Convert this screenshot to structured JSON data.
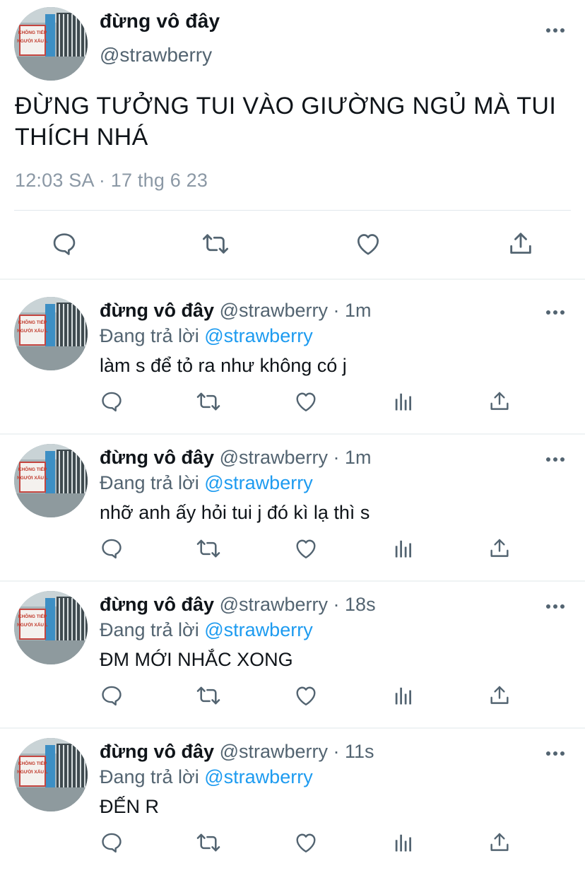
{
  "main_tweet": {
    "display_name": "đừng vô đây",
    "handle": "@strawberry",
    "text": "ĐỪNG TƯỞNG TUI VÀO GIƯỜNG NGỦ MÀ TUI THÍCH NHÁ",
    "timestamp": "12:03 SA · 17 thg 6 23",
    "avatar_sign_text": [
      "KHÔNG TIẾP",
      "NGƯỜI XẤU L"
    ],
    "actions": [
      "reply-icon",
      "retweet-icon",
      "like-icon",
      "share-icon"
    ]
  },
  "replies": [
    {
      "display_name": "đừng vô đây",
      "handle": "@strawberry",
      "dot": " · ",
      "time": "1m",
      "replying_label": "Đang trả lời ",
      "replying_to": "@strawberry",
      "text": "làm s để tỏ ra như không có j"
    },
    {
      "display_name": "đừng vô đây",
      "handle": "@strawberry",
      "dot": " · ",
      "time": "1m",
      "replying_label": "Đang trả lời ",
      "replying_to": "@strawberry",
      "text": "nhỡ anh ấy hỏi tui j đó kì lạ thì s"
    },
    {
      "display_name": "đừng vô đây",
      "handle": "@strawberry",
      "dot": " · ",
      "time": "18s",
      "replying_label": "Đang trả lời ",
      "replying_to": "@strawberry",
      "text": "ĐM MỚI NHẮC XONG"
    },
    {
      "display_name": "đừng vô đây",
      "handle": "@strawberry",
      "dot": " · ",
      "time": "11s",
      "replying_label": "Đang trả lời ",
      "replying_to": "@strawberry",
      "text": "ĐẾN R"
    }
  ],
  "colors": {
    "text_primary": "#0f1419",
    "text_secondary": "#536471",
    "link": "#1d9bf0",
    "divider": "#eff3f4"
  }
}
